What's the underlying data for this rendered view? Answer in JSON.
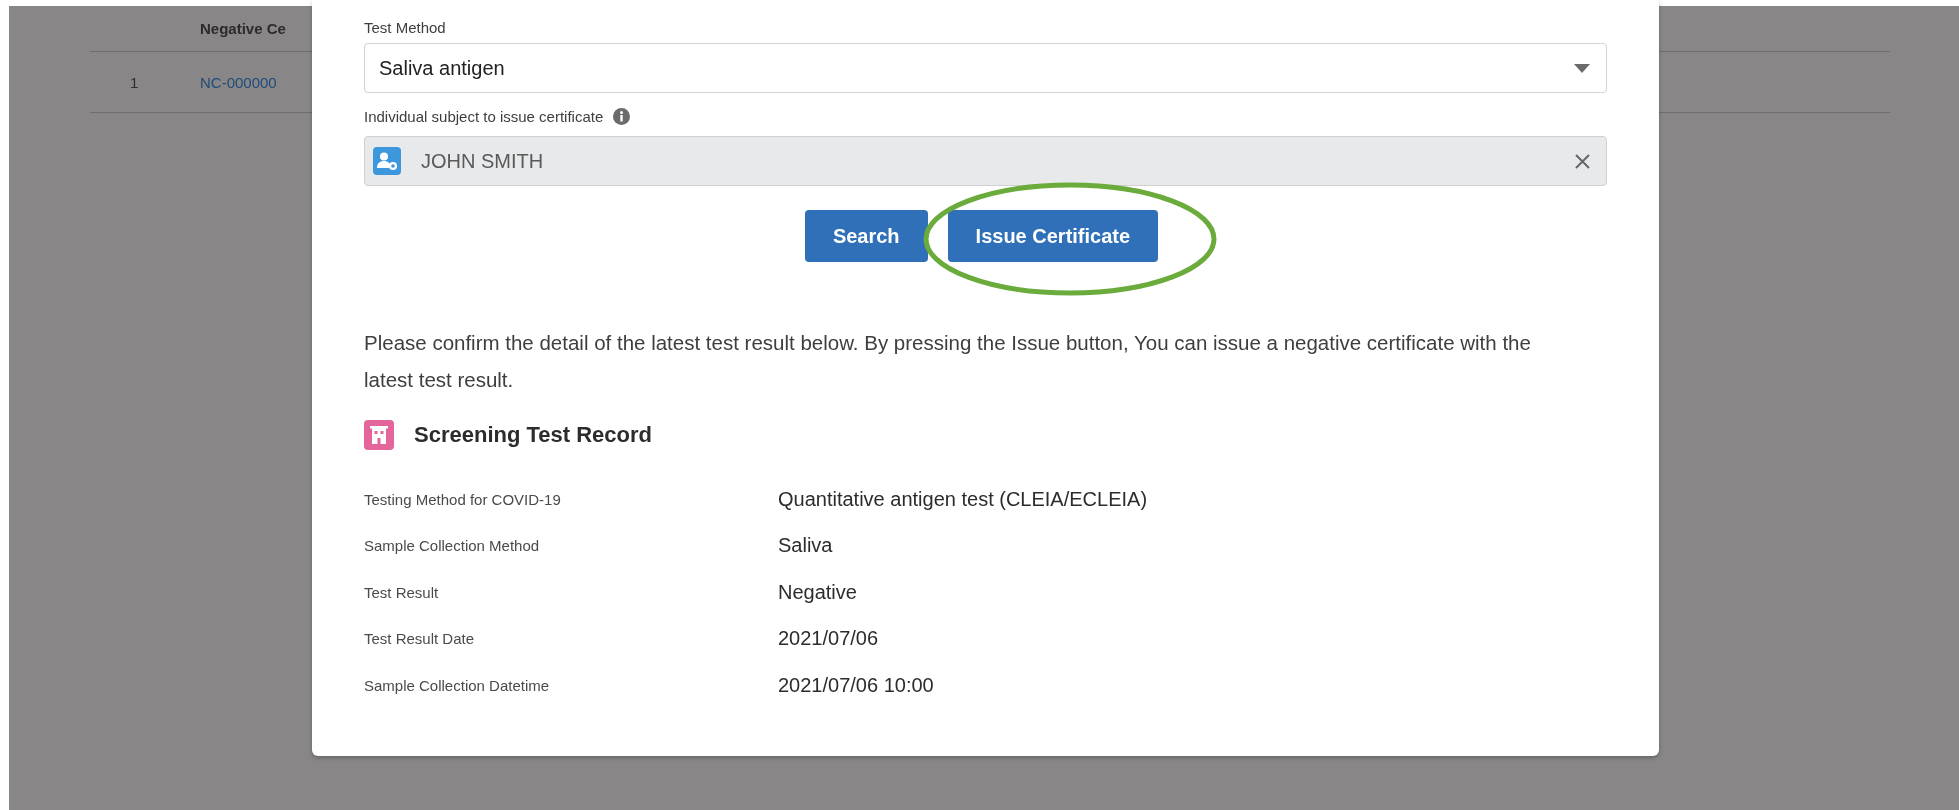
{
  "background_table": {
    "columns": [
      "Negative Ce"
    ],
    "rows": [
      {
        "number": "1",
        "cells": [
          "NC-000000"
        ]
      }
    ]
  },
  "modal": {
    "test_method": {
      "label": "Test Method",
      "value": "Saliva antigen"
    },
    "subject": {
      "label": "Individual subject to issue certificate",
      "value": "JOHN SMITH"
    },
    "buttons": [
      {
        "label": "Search",
        "highlighted": false
      },
      {
        "label": "Issue Certificate",
        "highlighted": true
      }
    ],
    "message": "Please confirm the detail of the latest test result below. By pressing the Issue button, You can issue a negative certificate with the latest test result.",
    "record": {
      "title": "Screening Test Record",
      "fields": [
        {
          "label": "Testing Method for COVID-19",
          "value": "Quantitative antigen test (CLEIA/ECLEIA)"
        },
        {
          "label": "Sample Collection Method",
          "value": "Saliva"
        },
        {
          "label": "Test Result",
          "value": "Negative"
        },
        {
          "label": "Test Result Date",
          "value": "2021/07/06"
        },
        {
          "label": "Sample Collection Datetime",
          "value": "2021/07/06 10:00"
        }
      ]
    }
  }
}
